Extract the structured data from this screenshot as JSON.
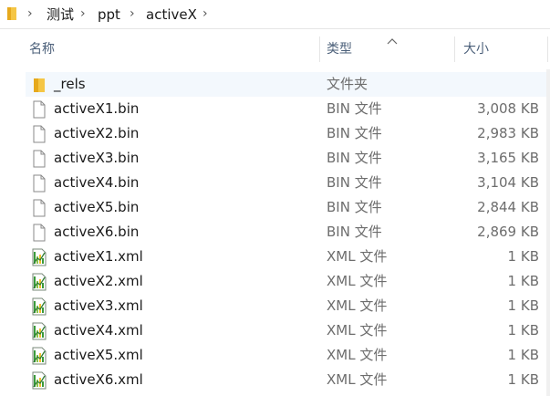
{
  "breadcrumb": {
    "items": [
      "测试",
      "ppt",
      "activeX"
    ]
  },
  "columns": {
    "name": "名称",
    "type": "类型",
    "size": "大小"
  },
  "files": [
    {
      "name": "_rels",
      "type": "文件夹",
      "size": "",
      "icon": "folder-icon"
    },
    {
      "name": "activeX1.bin",
      "type": "BIN 文件",
      "size": "3,008 KB",
      "icon": "file-icon"
    },
    {
      "name": "activeX2.bin",
      "type": "BIN 文件",
      "size": "2,983 KB",
      "icon": "file-icon"
    },
    {
      "name": "activeX3.bin",
      "type": "BIN 文件",
      "size": "3,165 KB",
      "icon": "file-icon"
    },
    {
      "name": "activeX4.bin",
      "type": "BIN 文件",
      "size": "3,104 KB",
      "icon": "file-icon"
    },
    {
      "name": "activeX5.bin",
      "type": "BIN 文件",
      "size": "2,844 KB",
      "icon": "file-icon"
    },
    {
      "name": "activeX6.bin",
      "type": "BIN 文件",
      "size": "2,869 KB",
      "icon": "file-icon"
    },
    {
      "name": "activeX1.xml",
      "type": "XML 文件",
      "size": "1 KB",
      "icon": "xml-file-icon"
    },
    {
      "name": "activeX2.xml",
      "type": "XML 文件",
      "size": "1 KB",
      "icon": "xml-file-icon"
    },
    {
      "name": "activeX3.xml",
      "type": "XML 文件",
      "size": "1 KB",
      "icon": "xml-file-icon"
    },
    {
      "name": "activeX4.xml",
      "type": "XML 文件",
      "size": "1 KB",
      "icon": "xml-file-icon"
    },
    {
      "name": "activeX5.xml",
      "type": "XML 文件",
      "size": "1 KB",
      "icon": "xml-file-icon"
    },
    {
      "name": "activeX6.xml",
      "type": "XML 文件",
      "size": "1 KB",
      "icon": "xml-file-icon"
    }
  ],
  "colors": {
    "folder": "#f5c645",
    "header_text": "#4c607a",
    "meta_text": "#6d6d6d",
    "selected_row": "#f3f8fd"
  }
}
